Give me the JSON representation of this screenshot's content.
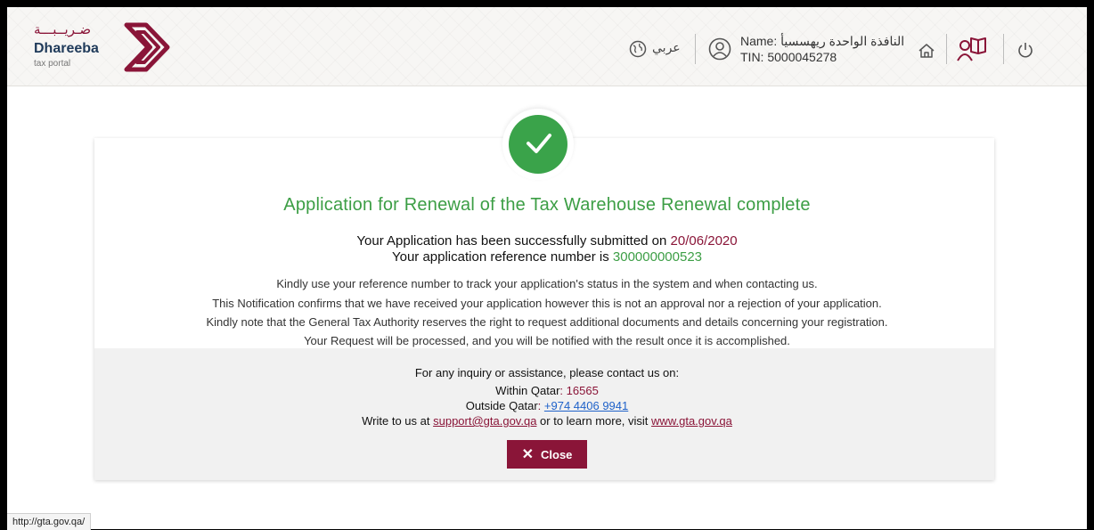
{
  "header": {
    "logo_arabic": "ضـريــبـــة",
    "logo_name": "Dhareeba",
    "logo_sub": "tax portal",
    "language_label": "عربي",
    "user_name_line": "Name: النافذة الواحدة ريهسسيأ",
    "user_tin_line": "TIN: 5000045278"
  },
  "main": {
    "title": "Application for Renewal of the Tax Warehouse Renewal complete",
    "submitted_prefix": "Your Application has been successfully submitted on",
    "submitted_date": "20/06/2020",
    "reference_prefix": "Your application reference number is",
    "reference_number": "300000000523",
    "info": [
      "Kindly use your reference number to track your application's status in the system and when contacting us.",
      "This Notification confirms that we have received your application however this is not an approval nor a rejection of your application.",
      "Kindly note that the General Tax Authority reserves the right to request additional documents and details concerning your registration.",
      "Your Request will be processed, and you will be notified with the result once it is accomplished."
    ]
  },
  "contact": {
    "heading": "For any inquiry or assistance, please contact us on:",
    "within_label": "Within Qatar",
    "within_number": "16565",
    "outside_label": "Outside Qatar",
    "outside_number": "+974 4406 9941",
    "write_prefix": "Write to us at",
    "email": "support@gta.gov.qa",
    "write_middle": "or to learn more, visit",
    "website": "www.gta.gov.qa"
  },
  "close_label": "Close",
  "status_bar_url": "http://gta.gov.qa/",
  "colors": {
    "brand": "#8a1538",
    "success": "#3aa34a",
    "link": "#1f62c9"
  }
}
